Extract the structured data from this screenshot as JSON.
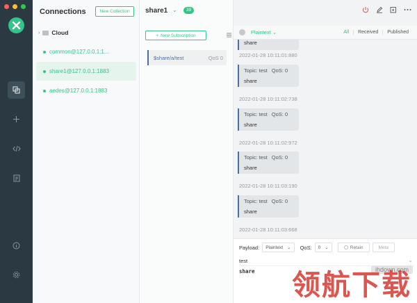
{
  "colors": {
    "accent": "#34c388",
    "rail": "#2b3a42",
    "message_border": "#4a6fa5"
  },
  "rail": {
    "traffic_lights": [
      "#fc605c",
      "#fdbc40",
      "#34c84a"
    ],
    "icons": [
      "copy-icon",
      "plus-icon",
      "code-icon",
      "script-icon",
      "info-icon",
      "gear-icon"
    ]
  },
  "connections": {
    "title": "Connections",
    "new_collection_label": "New Collection",
    "cloud_label": "Cloud",
    "items": [
      {
        "label": "common@127.0.0.1:1..."
      },
      {
        "label": "share1@127.0.0.1:1883"
      },
      {
        "label": "aedes@127.0.0.1:1883"
      }
    ]
  },
  "subscriptions": {
    "connection_name": "share1",
    "message_count": "39",
    "new_subscription_label": "New Subscription",
    "items": [
      {
        "topic": "$share/a/test",
        "qos": "QoS 0"
      }
    ]
  },
  "messages": {
    "format": "Plaintext",
    "tabs": [
      "All",
      "Received",
      "Published"
    ],
    "first_partial": {
      "payload": "share",
      "time": "2022-01-28 10:11:01:880"
    },
    "list": [
      {
        "topic": "Topic: test",
        "qos": "QoS: 0",
        "payload": "share",
        "time": "2022-01-28 10:11:02:738"
      },
      {
        "topic": "Topic: test",
        "qos": "QoS: 0",
        "payload": "share",
        "time": "2022-01-28 10:11:02:972"
      },
      {
        "topic": "Topic: test",
        "qos": "QoS: 0",
        "payload": "share",
        "time": "2022-01-28 10:11:03:190"
      },
      {
        "topic": "Topic: test",
        "qos": "QoS: 0",
        "payload": "share",
        "time": "2022-01-28 10:11:03:668"
      }
    ]
  },
  "composer": {
    "payload_label": "Payload:",
    "payload_format": "Plaintext",
    "qos_label": "QoS:",
    "qos_value": "0",
    "retain_label": "Retain",
    "meta_label": "Meta",
    "topic_value": "test",
    "payload_value": "share"
  },
  "watermark": {
    "url": "ihdown.com",
    "text": "领航下载"
  }
}
